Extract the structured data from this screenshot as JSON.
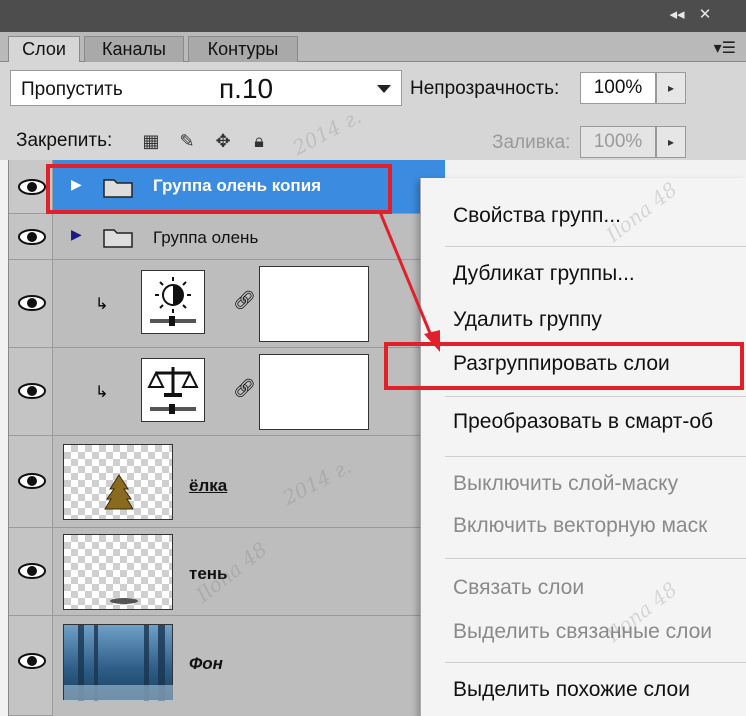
{
  "tabs": [
    "Слои",
    "Каналы",
    "Контуры"
  ],
  "blend_mode": {
    "value": "Пропустить",
    "extra": "п.10"
  },
  "opacity": {
    "label": "Непрозрачность:",
    "value": "100%"
  },
  "lock": {
    "label": "Закрепить:"
  },
  "fill": {
    "label": "Заливка:",
    "value": "100%"
  },
  "layers": [
    {
      "name": "Группа олень копия",
      "type": "group",
      "selected": true
    },
    {
      "name": "Группа олень",
      "type": "group"
    },
    {
      "type": "adjustment",
      "icon": "brightness-contrast-icon"
    },
    {
      "type": "adjustment",
      "icon": "color-balance-icon"
    },
    {
      "name": "ёлка",
      "type": "layer"
    },
    {
      "name": "тень",
      "type": "layer"
    },
    {
      "name": "Фон",
      "type": "background"
    }
  ],
  "context_menu": [
    {
      "label": "Свойства групп...",
      "enabled": true
    },
    {
      "label": "Дубликат группы...",
      "enabled": true
    },
    {
      "label": "Удалить группу",
      "enabled": true
    },
    {
      "label": "Разгруппировать слои",
      "enabled": true,
      "highlighted": true
    },
    {
      "label": "Преобразовать в смарт-об",
      "enabled": true
    },
    {
      "label": "Выключить слой-маску",
      "enabled": false
    },
    {
      "label": "Включить векторную маск",
      "enabled": false
    },
    {
      "label": "Связать слои",
      "enabled": false
    },
    {
      "label": "Выделить связанные слои",
      "enabled": false
    },
    {
      "label": "Выделить похожие слои",
      "enabled": true
    }
  ],
  "watermarks": [
    "2014 г.",
    "Ilona 48",
    "2014 г.",
    "Ilona 48",
    "Ilona 48"
  ],
  "colors": {
    "selection": "#3b8be0",
    "highlight_box": "#e0202a",
    "panel": "#bdbdbd"
  }
}
